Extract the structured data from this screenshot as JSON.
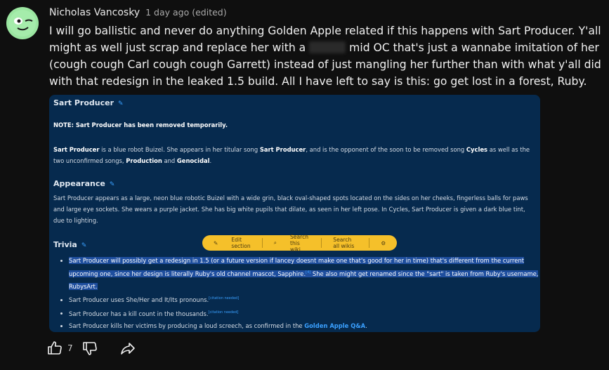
{
  "comment": {
    "author": "Nicholas Vancosky",
    "meta": "1 day ago (edited)",
    "text_before": "I will go ballistic and never do anything Golden Apple related if this happens with Sart Producer. Y'all might as well just scrap and replace her with a",
    "text_after": "mid OC that's just a wannabe imitation of her (cough cough Carl cough cough Garrett) instead of just mangling her further than with what y'all did with that redesign in the leaked 1.5 build. All I have left to say is this: go get lost in a forest, Ruby."
  },
  "wiki": {
    "title": "Sart Producer",
    "note": "NOTE: Sart Producer has been removed temporarily.",
    "intro": {
      "name": "Sart Producer",
      "t1": "is a blue robot Buizel. She appears in her titular song",
      "song": "Sart Producer",
      "t2": ", and is the opponent of the soon to be removed song",
      "cycles": "Cycles",
      "t3": "as well as the two unconfirmed songs,",
      "production": "Production",
      "t4": "and",
      "genocidal": "Genocidal",
      "t5": "."
    },
    "appearance_heading": "Appearance",
    "appearance_text": "Sart Producer appears as a large, neon blue robotic Buizel with a wide grin, black oval-shaped spots located on the sides on her cheeks, fingerless balls for paws and large eye sockets. She wears a purple jacket. She has big white pupils that dilate, as seen in her left pose. In Cycles, Sart Producer is given a dark blue tint, due to lighting.",
    "trivia_heading": "Trivia",
    "trivia": {
      "t1": "Sart Producer will possibly get a redesign in 1.5 (or a future version if lancey doesnt make one that's good for her in time) that's different from the current upcoming one, since her design is literally Ruby's old channel mascot, Sapphire.",
      "t1_sup": "[4]",
      "t1b": "She also might get renamed since the \"sart\" is taken from Ruby's username, RubysArt.",
      "t2": "Sart Producer uses She/Her and It/Its pronouns.",
      "t2_sup": "[citation needed]",
      "t3": "Sart Producer has a kill count in the thousands.",
      "t3_sup": "[citation needed]",
      "t4": "Sart Producer kills her victims by producing a loud screech, as confirmed in the",
      "t4_link": "Golden Apple Q&A",
      "t4_end": "."
    },
    "toolbar": {
      "edit": "Edit section",
      "search_wiki": "Search this wiki",
      "search_all": "Search all wikis"
    }
  },
  "actions": {
    "like_count": "7"
  }
}
